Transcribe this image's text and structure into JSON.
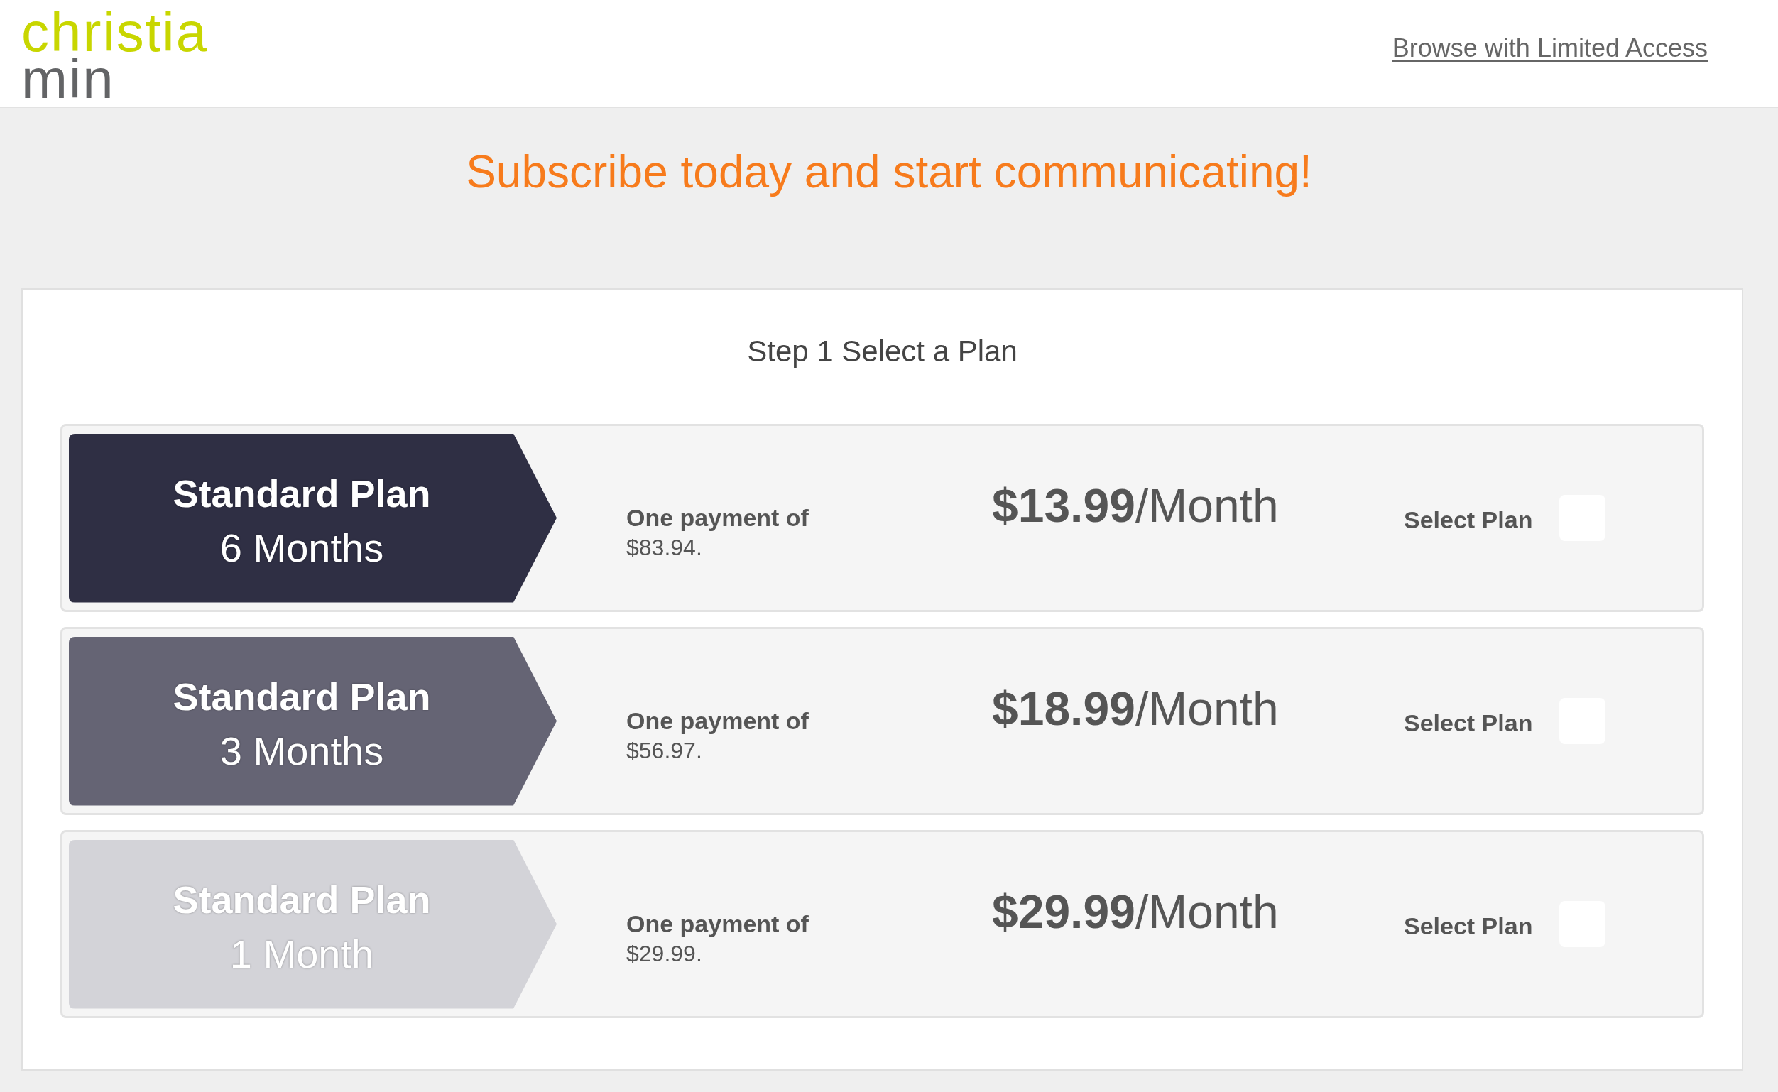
{
  "header": {
    "logo": {
      "line_1": "christia",
      "line_2": "min"
    },
    "link": "Browse with Limited Access"
  },
  "headline": "Subscribe today and start communicating!",
  "panel": {
    "title": "Step 1 Select a Plan",
    "plans": [
      {
        "name": "Standard Plan",
        "duration": "6 Months",
        "color": "#2f2f44",
        "payment_label": "One payment of",
        "payment_amount": "$83.94.",
        "price": "**$13.99**/Month",
        "select_label": "Select Plan",
        "checked": false
      },
      {
        "name": "Standard Plan",
        "duration": "3 Months",
        "color": "#656474",
        "payment_label": "One payment of",
        "payment_amount": "$56.97.",
        "price": "**$18.99**/Month",
        "select_label": "Select Plan",
        "checked": false
      },
      {
        "name": "Standard Plan",
        "duration": "1 Month",
        "color": "#d3d3d8",
        "payment_label": "One payment of",
        "payment_amount": "$29.99.",
        "price": "**$29.99**/Month",
        "select_label": "Select Plan",
        "checked": false
      }
    ]
  }
}
